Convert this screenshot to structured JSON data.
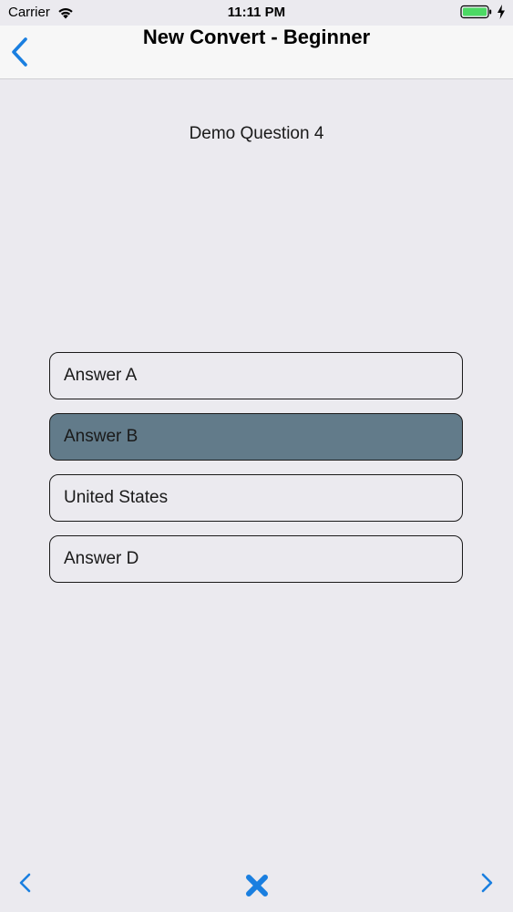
{
  "status_bar": {
    "carrier": "Carrier",
    "time": "11:11 PM",
    "icons": [
      "wifi-icon",
      "battery-icon",
      "charging-bolt-icon"
    ]
  },
  "nav": {
    "title": "New Convert - Beginner",
    "back_icon": "chevron-left-icon"
  },
  "question": {
    "text": "Demo Question 4"
  },
  "answers": [
    {
      "label": "Answer A",
      "selected": false
    },
    {
      "label": "Answer B",
      "selected": true
    },
    {
      "label": "United States",
      "selected": false
    },
    {
      "label": "Answer D",
      "selected": false
    }
  ],
  "toolbar": {
    "prev_icon": "chevron-left-icon",
    "close_icon": "close-x-icon",
    "next_icon": "chevron-right-icon"
  },
  "colors": {
    "accent": "#1a7fe0",
    "selected_answer": "#627b8a",
    "background": "#ebeaef",
    "battery": "#4cd964"
  }
}
